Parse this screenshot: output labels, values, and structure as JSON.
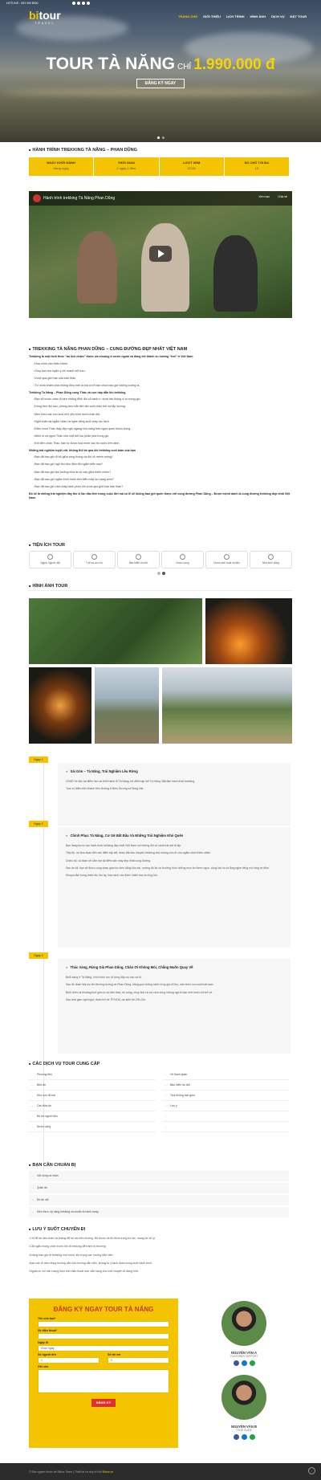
{
  "header": {
    "topbar": [
      "HOTLINE : 094 999 8000"
    ],
    "logo_main": "tour",
    "logo_b": "bi",
    "logo_sub": "TRAVEL",
    "nav": [
      "TRANG CHỦ",
      "GIỚI THIỆU",
      "LỊCH TRÌNH",
      "HÌNH ẢNH",
      "DỊCH VỤ",
      "ĐẶT TOUR"
    ]
  },
  "hero": {
    "title": "TOUR TÀ NĂNG",
    "connector": "CHỈ",
    "price": "1.990.000 đ",
    "cta": "ĐĂNG KÝ NGAY"
  },
  "journey": {
    "heading": "HÀNH TRÌNH TREKKING TÀ NĂNG – PHAN DŨNG",
    "cols": [
      {
        "label": "NGÀY KHỞI HÀNH",
        "value": "Hàng ngày"
      },
      {
        "label": "THỜI GIAN",
        "value": "2 ngày 2 đêm"
      },
      {
        "label": "LƯỢT XEM",
        "value": "37/26"
      },
      {
        "label": "SỐ CHỖ TỐI ĐA",
        "value": "15"
      }
    ]
  },
  "video": {
    "title": "Hành trình trekking Tà Năng Phan Dũng",
    "later": "Xem sau",
    "share": "Chia sẻ"
  },
  "intro": {
    "heading": "TREKKING TÀ NĂNG PHAN DŨNG – CUNG ĐƯỜNG ĐẸP NHẤT VIỆT NAM",
    "lead": "Trekking là một hình thức “du lịch chậm” được ưa chuộng ở nước ngoài và đang trở thành xu hướng “hot” ở Việt Nam",
    "list1": [
      "Hòa mình vào thiên nhiên.",
      "Giúp bạn rèn luyện ý chí mạnh mẽ hơn.",
      "Vượt qua giới hạn của bản thân.",
      "Tự mình khám phá những điều mới lạ mà có lẽ bạn chưa bao giờ tưởng tượng ra."
    ],
    "sub1": "Trekking Tà Năng – Phan Dũng cung Thác và cực hấp dẫn khi trekking",
    "list2": [
      "Bạn sẽ bước chân đi trên những đỉnh đồi cỏ xanh rì, dưới tán thông vi vu trong gió.",
      "Dòng trên đồi cao, phóng tầm mắt đến tận cuối chân trời xa tắp hướng.",
      "Men theo các con suối nhỏ yên bình dưới chân đồi.",
      "Nghỉ chân tại ngắm chân và nghe tiếng suối chảy róc rách.",
      "Đắm mình Thác thấy đẹp ngỡ ngàng như năng bên ngọn quen thuộc trong.",
      "Minh òi và ngơn Thác như một tiết lưu phân pha trong gió.",
      "Khi đêm chân Thac, bạn tự được hòa mình vào hồ nước trên lành."
    ],
    "sub2": "Những trải nghiệm tuyệt vời, không thể bỏ qua khi trekking cuối tuần của bạn",
    "list3": [
      "Bạn đã bao giờ đi bộ giữa rừng thông và đồi cỏ mênh mông?",
      "Bạn đã bao giờ ngủ lều trên đỉnh đồi ngắm biển sao?",
      "Bạn đã bao giờ tận hưởng bữa ăn tự nấu giữa thiên nhiên?",
      "Bạn đã bao giờ ngắm bình minh trên biển mây lúc sáng sớm?",
      "Bạn đã bao giờ cảm thấy hạnh phúc khi vượt qua giới hạn bản thân?"
    ],
    "closing": "Đó sẽ là những trải nghiệm đầy thú vị lần đầu tiên trong cuộc đời mà có lẽ sẽ không bao giờ quên được với cung đường Phan Dũng – Được mệnh danh là cung đường trekking đẹp nhất Việt Nam."
  },
  "amenities": {
    "heading": "TIỆN ÍCH TOUR",
    "items": [
      "Ngựa, Người dắt",
      "Y tế và cứu hộ",
      "Bảo hiểm du lịch",
      "Nước uống",
      "Nước sinh hoạt và tắm",
      "Nhà bình đông"
    ]
  },
  "gallery": {
    "heading": "HÌNH ẢNH TOUR"
  },
  "itinerary": [
    {
      "day": "Ngày 1",
      "title": "Sài Gòn – Tà Năng, Trải Nghiệm Lều Rừng",
      "paras": [
        "22h30 Xe đón tại điểm hẹn và khởi hành đi Tà Năng, tới điểm tập kết Tà Năng. Bắt đầu hành trình trekking.",
        "Tour có điểm đón khách trên đường ở Bình Dương và Đồng Nai."
      ]
    },
    {
      "day": "Ngày 2",
      "title": "Chinh Phục Tà Năng, Cơ Sở Bất Đầu Và Những Trải Nghiệm Khó Quên",
      "paras": [
        "Bạn đang bước vào hành trình trekking đẹp nhất Việt Nam với những đồi cỏ xanh trải dài tít tắp.",
        "Tiếp đó, xe đưa đoàn đến các điểm tập kết, đoàn bắt đầu chuyến trekking nhẹ nhàng vừa đi vừa ngắm cảnh thiên nhiên.",
        "Chiều tối, cả đoàn sẽ cắm trại tại điểm săn mây đẹp nhất cung đường.",
        "Sau ăn tối, bạn sẽ được cùng nhau giao lưu bên đống lửa trại, nướng đồ ăn và thưởng thức những món ăn thơm ngon, cùng hát hò và lắng nghe tiếng núi rừng về đêm.",
        "Khuya nằm trong chiếc lều lớn ấy, hòa mình vào thiên nhiên bao la rộng lớn."
      ]
    },
    {
      "day": "Ngày 3",
      "title": "Thác Vàng, Rừng Già Phan Dũng, Chân Ơi Không Mỏi, Chẳng Muốn Quay Về",
      "paras": [
        "Buổi sáng ở Tà Năng, bình minh rực rỡ từng dãy núi cao xa tít.",
        "Sau đó đoàn tiếp tục lên đường hướng về Phan Dũng, băng qua những cánh rừng già cổ thụ, men theo con suối mát lạnh.",
        "Buổi chiều là khoảng thời gian tự do tắm thác, ăn uống, chụp ảnh và vui chơi cùng những người bạn mới trước khi trở về.",
        "Sau thời gian nghỉ ngơi, đoàn trở về TP.HCM, dự kiến tới 20h-21h."
      ]
    }
  ],
  "services": {
    "heading": "CÁC DỊCH VỤ TOUR CUNG CẤP",
    "items": [
      "Phương tiện",
      "Vé tham quan",
      "Bữa ăn",
      "Bảo hiểm du lịch",
      "Khu vực đủ trại",
      "Tour không bao gồm",
      "Các bữa ăn",
      "Lưu ý",
      "Bộ trợ người tiếu",
      "Nước uống"
    ]
  },
  "prepare": {
    "heading": "BẠN CẦN CHUẨN BỊ",
    "items": [
      "Vật dụng cá nhân",
      "Quần áo",
      "Đồ ăn vặt",
      "Kiến thức, kỹ năng trekking và chuẩn bị hành trang"
    ]
  },
  "notes": {
    "heading": "LƯU Ý SUỐT CHUYẾN ĐI",
    "items": [
      "Chỉ để lại dấu chân và không để lại rác trên đường. Bỏ thuốc và đồ thừa trong túi rác, mang về xử lý.",
      "Cắt ngắn móng chân trước khi đi trekking để tránh bị thương.",
      "Không bao giờ đi trekking một mình, tôn trọng các hướng dẫn viên.",
      "Bạn cần đi theo đúng hướng dẫn của hướng dẫn viên, không tự ý tách đoàn trong suốt hành trình.",
      "Ngoài ra, chỉ cần mang theo tinh thần thoải mái, sẵn sàng cho một chuyến đi đáng nhớ."
    ]
  },
  "form": {
    "title": "ĐĂNG KÝ NGAY TOUR TÀ NĂNG",
    "name": "Tên của bạn*",
    "phone": "Số điện thoại*",
    "date": "Ngày đi",
    "date_ph": "Chọn ngày",
    "adults": "Số người lớn",
    "adults_v": "1",
    "kids": "Số trẻ em",
    "kids_v": "0",
    "note": "Ghi chú",
    "submit": "ĐĂNG KÝ"
  },
  "staff": [
    {
      "name": "NGUYỄN VĂN A",
      "role": "CUSTOMER SUPPORT"
    },
    {
      "name": "NGUYỄN VĂN B",
      "role": "TOUR GUIDE"
    }
  ],
  "footer": {
    "text": "© Bản quyền thuộc về Bitour Team | Thiết kế và duy trì bởi",
    "brand": "Bitour.vn"
  },
  "colors": {
    "accent": "#f5c400",
    "danger": "#e0302a"
  }
}
